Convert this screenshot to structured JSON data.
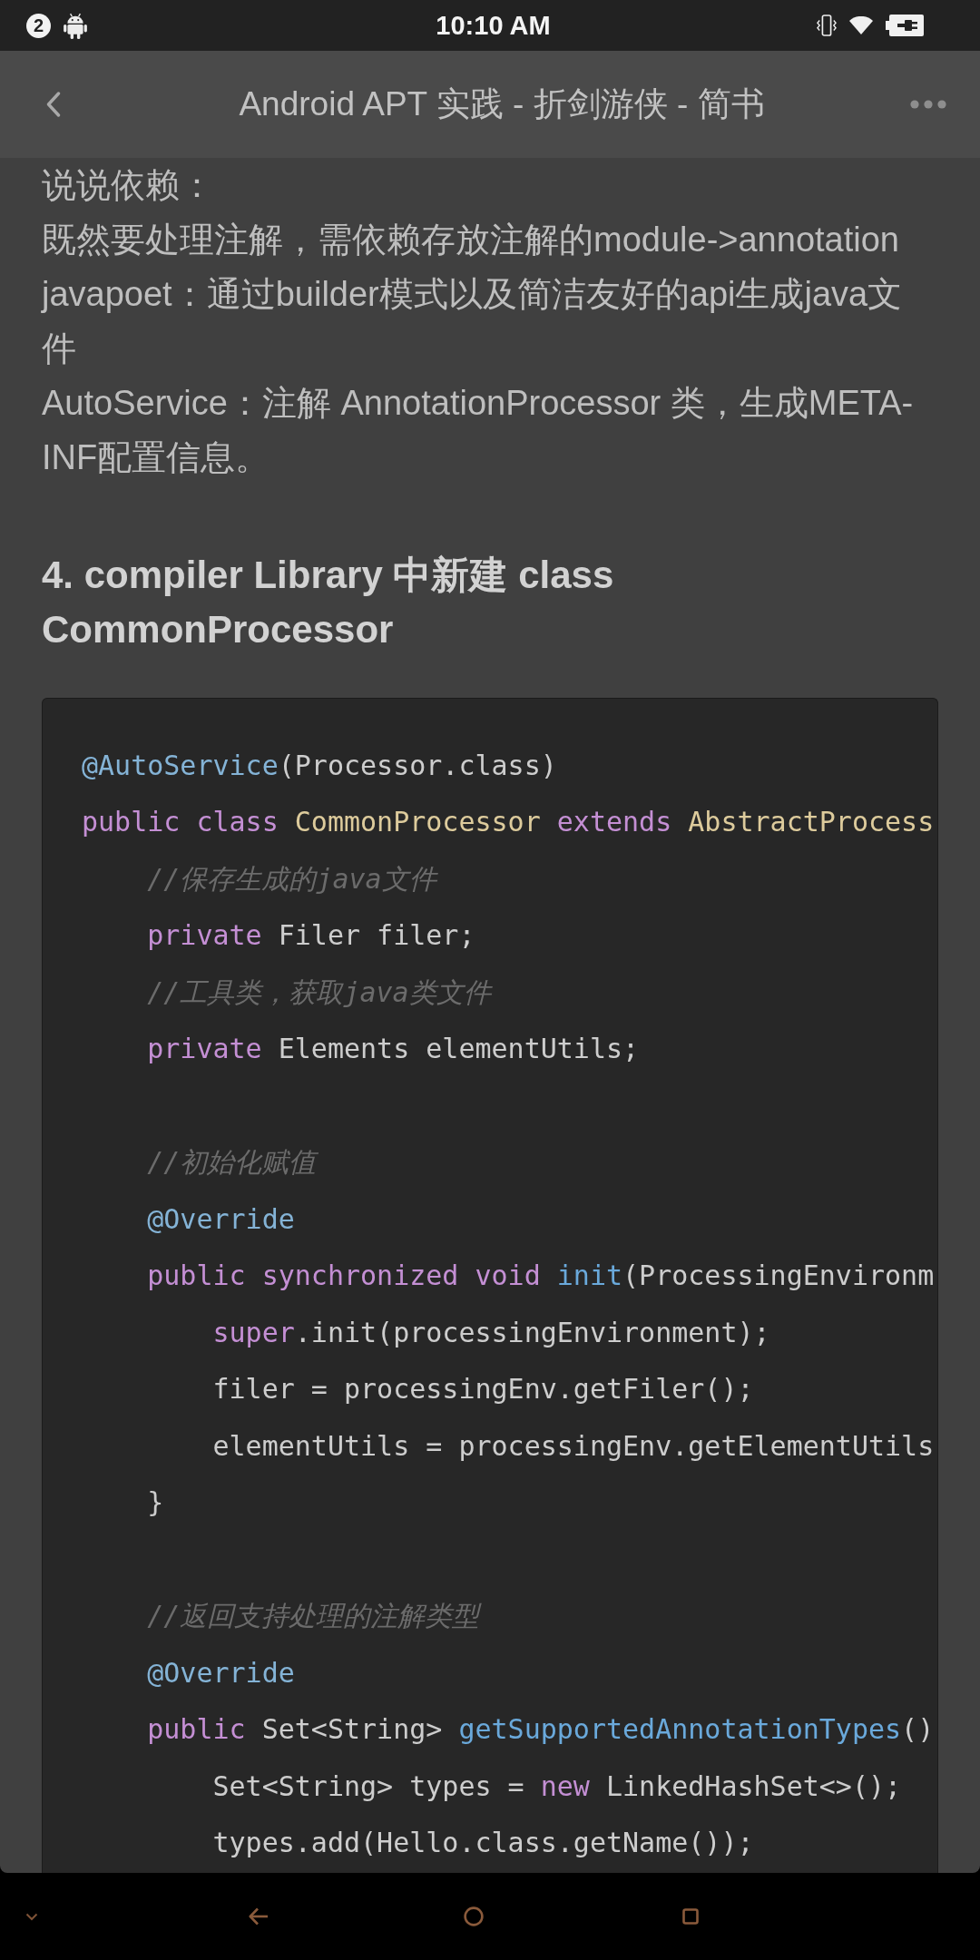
{
  "status_bar": {
    "notification_count": "2",
    "time": "10:10 AM"
  },
  "toolbar": {
    "title": "Android APT 实践 - 折剑游侠 - 简书"
  },
  "article": {
    "paragraphs": [
      "说说依赖：",
      "既然要处理注解，需依赖存放注解的module->annotation",
      "javapoet：通过builder模式以及简洁友好的api生成java文件",
      "AutoService：注解 AnnotationProcessor 类，生成META-INF配置信息。"
    ],
    "heading": "4. compiler Library 中新建 class CommonProcessor",
    "code_block": {
      "lines": [
        {
          "kind": "code",
          "tokens": [
            {
              "text": "@AutoService",
              "kind": "meta"
            },
            {
              "text": "(Processor.class)",
              "kind": "plain"
            }
          ]
        },
        {
          "kind": "code",
          "tokens": [
            {
              "text": "public",
              "kind": "keyword"
            },
            {
              "text": " class",
              "kind": "keyword"
            },
            {
              "text": " CommonProcessor",
              "kind": "title"
            },
            {
              "text": " extends",
              "kind": "keyword"
            },
            {
              "text": " AbstractProcess",
              "kind": "title"
            }
          ],
          "children": [
            {
              "kind": "code",
              "tokens": [
                {
                  "text": "//保存生成的java文件",
                  "kind": "comment"
                }
              ]
            },
            {
              "kind": "code",
              "tokens": [
                {
                  "text": "private",
                  "kind": "keyword"
                },
                {
                  "text": " Filer filer;",
                  "kind": "plain"
                }
              ]
            },
            {
              "kind": "code",
              "tokens": [
                {
                  "text": "//工具类，获取java类文件",
                  "kind": "comment"
                }
              ]
            },
            {
              "kind": "code",
              "tokens": [
                {
                  "text": "private",
                  "kind": "keyword"
                },
                {
                  "text": " Elements elementUtils;",
                  "kind": "plain"
                }
              ]
            },
            {
              "kind": "blank"
            },
            {
              "kind": "code",
              "tokens": [
                {
                  "text": "//初始化赋值",
                  "kind": "comment"
                }
              ]
            },
            {
              "kind": "code",
              "tokens": [
                {
                  "text": "@Override",
                  "kind": "meta"
                }
              ]
            },
            {
              "kind": "code",
              "tokens": [
                {
                  "text": "public",
                  "kind": "keyword"
                },
                {
                  "text": " synchronized",
                  "kind": "keyword"
                },
                {
                  "text": " void",
                  "kind": "keyword"
                },
                {
                  "text": " init",
                  "kind": "function"
                },
                {
                  "text": "(ProcessingEnvironm",
                  "kind": "plain"
                }
              ],
              "children": [
                {
                  "kind": "code",
                  "tokens": [
                    {
                      "text": "super",
                      "kind": "keyword"
                    },
                    {
                      "text": ".init(processingEnvironment);",
                      "kind": "plain"
                    }
                  ]
                },
                {
                  "kind": "code",
                  "tokens": [
                    {
                      "text": "filer = processingEnv.getFiler();",
                      "kind": "plain"
                    }
                  ]
                },
                {
                  "kind": "code",
                  "tokens": [
                    {
                      "text": "elementUtils = processingEnv.getElementUtils",
                      "kind": "plain"
                    }
                  ]
                }
              ]
            },
            {
              "kind": "code",
              "tokens": [
                {
                  "text": "}",
                  "kind": "plain"
                }
              ]
            },
            {
              "kind": "blank"
            },
            {
              "kind": "code",
              "tokens": [
                {
                  "text": "//返回支持处理的注解类型",
                  "kind": "comment"
                }
              ]
            },
            {
              "kind": "code",
              "tokens": [
                {
                  "text": "@Override",
                  "kind": "meta"
                }
              ]
            },
            {
              "kind": "code",
              "tokens": [
                {
                  "text": "public",
                  "kind": "keyword"
                },
                {
                  "text": " Set<String>",
                  "kind": "plain"
                },
                {
                  "text": " getSupportedAnnotationTypes",
                  "kind": "function"
                },
                {
                  "text": "()",
                  "kind": "plain"
                }
              ],
              "children": [
                {
                  "kind": "code",
                  "tokens": [
                    {
                      "text": "Set<String> types = ",
                      "kind": "plain"
                    },
                    {
                      "text": "new",
                      "kind": "keyword"
                    },
                    {
                      "text": " LinkedHashSet<>();",
                      "kind": "plain"
                    }
                  ]
                },
                {
                  "kind": "code",
                  "tokens": [
                    {
                      "text": "types.add(Hello.class.getName());",
                      "kind": "plain"
                    }
                  ]
                }
              ]
            }
          ]
        }
      ]
    }
  }
}
